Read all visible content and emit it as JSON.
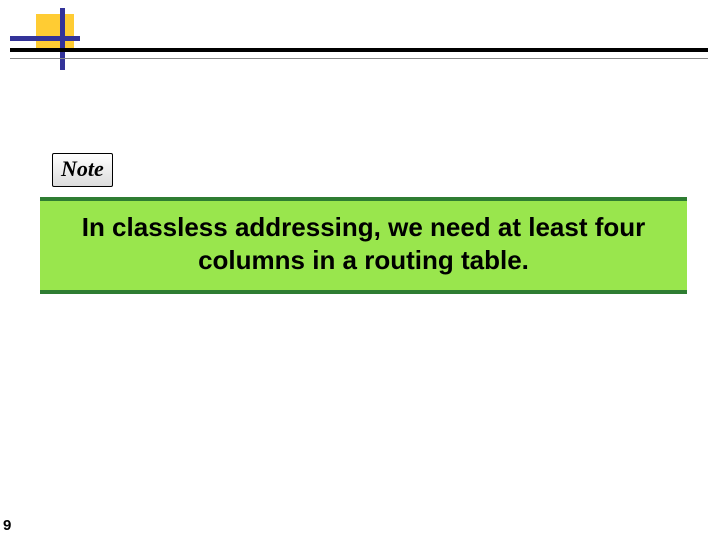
{
  "note_label": "Note",
  "note_text": "In classless addressing, we need at least four columns in a routing table.",
  "page_number": "9"
}
